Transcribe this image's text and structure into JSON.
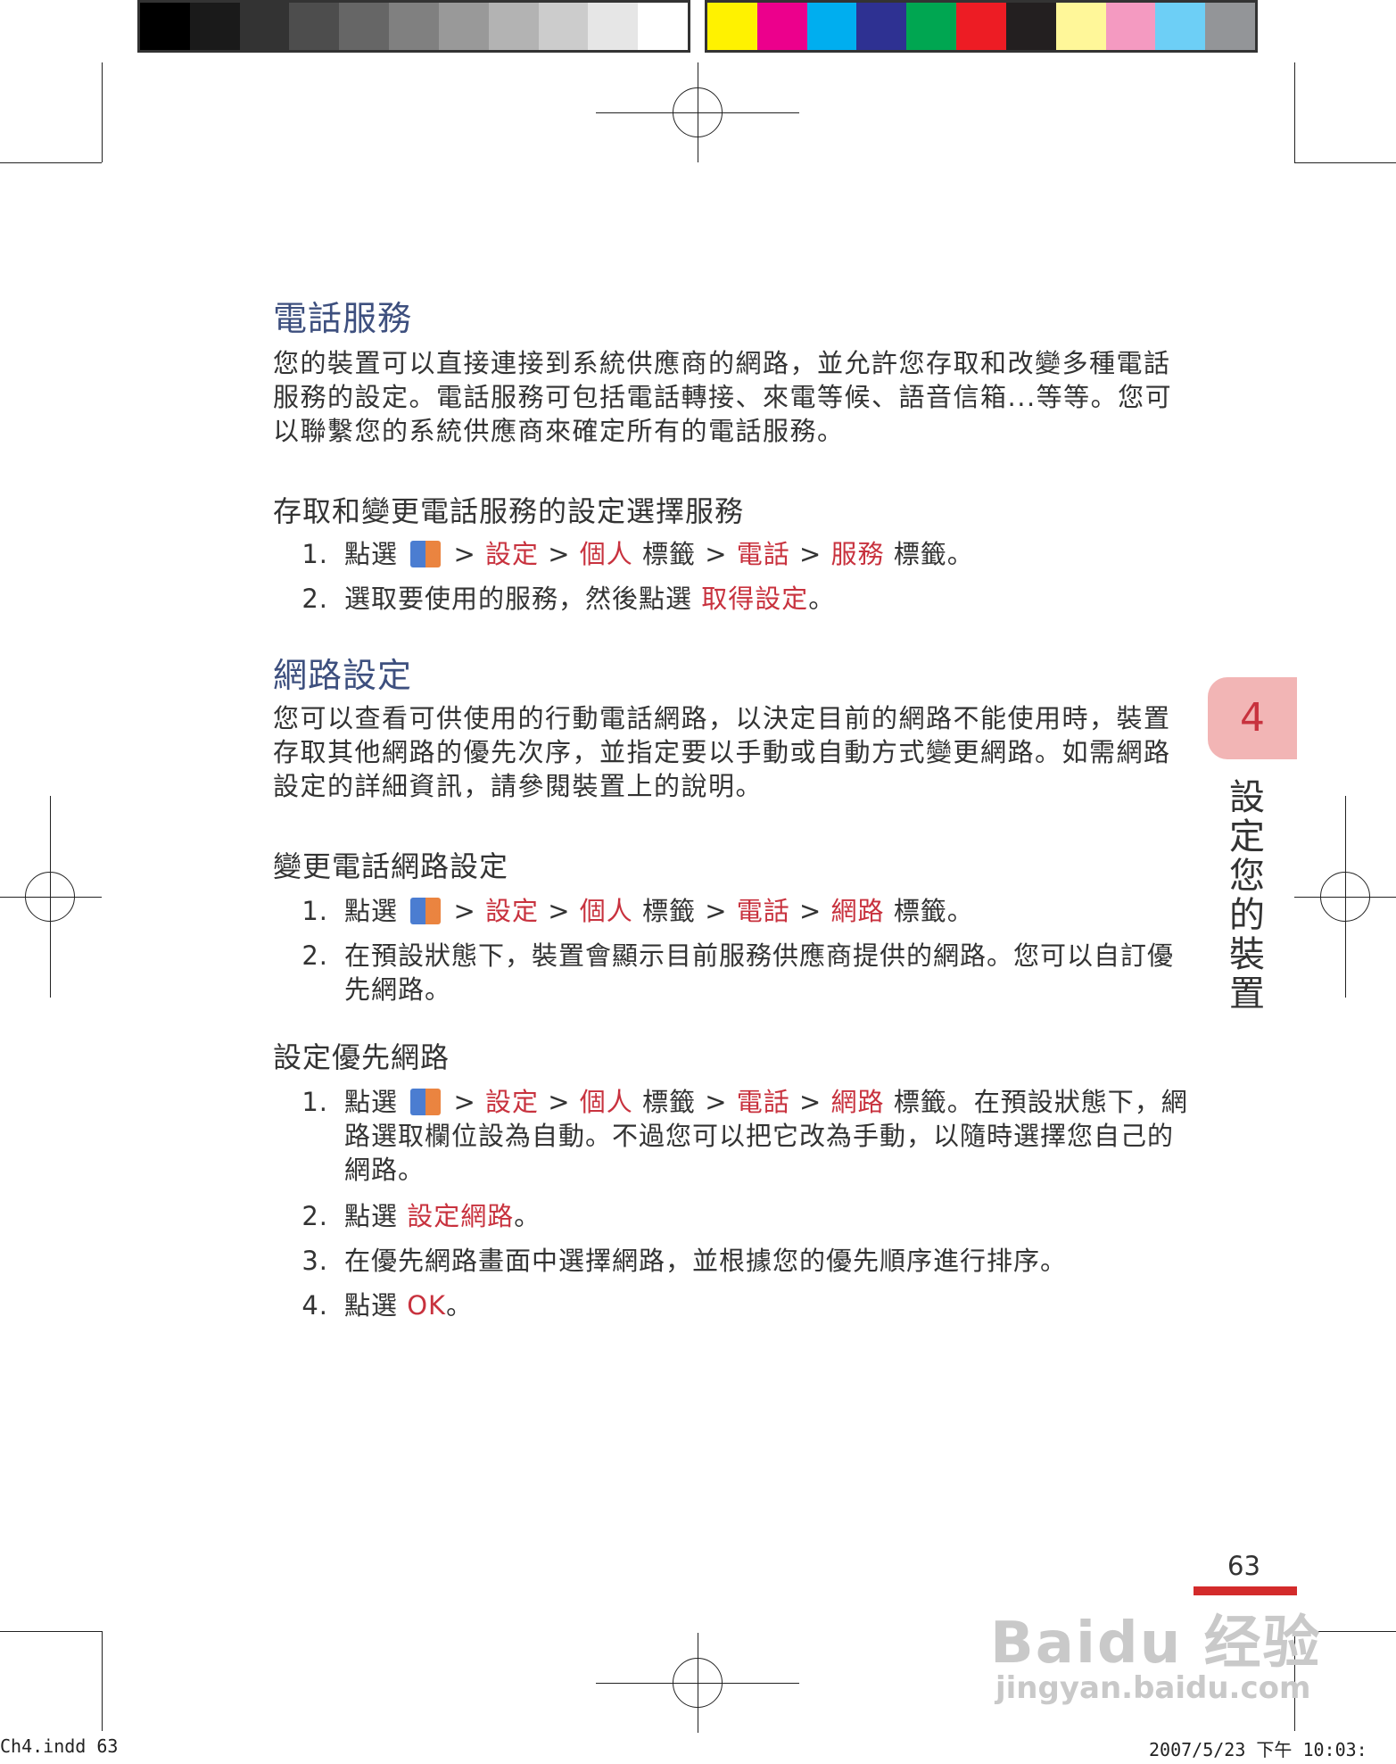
{
  "sections": [
    {
      "title": "電話服務",
      "paragraph": "您的裝置可以直接連接到系統供應商的網路，並允許您存取和改變多種電話服務的設定。電話服務可包括電話轉接、來電等候、語音信箱...等等。您可以聯繫您的系統供應商來確定所有的電話服務。",
      "subsection": "存取和變更電話服務的設定選擇服務",
      "steps": [
        {
          "num": "1.",
          "pre": "點選",
          "path": [
            "設定",
            "個人",
            "標籤",
            "電話",
            "服務",
            "標籤。"
          ]
        },
        {
          "num": "2.",
          "text": "選取要使用的服務，然後點選",
          "red": "取得設定",
          "post": "。"
        }
      ]
    },
    {
      "title": "網路設定",
      "paragraph": "您可以查看可供使用的行動電話網路，以決定目前的網路不能使用時，裝置存取其他網路的優先次序，並指定要以手動或自動方式變更網路。如需網路設定的詳細資訊，請參閱裝置上的說明。",
      "subsection_a": "變更電話網路設定",
      "steps_a": [
        {
          "num": "1.",
          "pre": "點選",
          "path": [
            "設定",
            "個人",
            "標籤",
            "電話",
            "網路",
            "標籤。"
          ]
        },
        {
          "num": "2.",
          "text": "在預設狀態下，裝置會顯示目前服務供應商提供的網路。您可以自訂優先網路。"
        }
      ],
      "subsection_b": "設定優先網路",
      "steps_b": [
        {
          "num": "1.",
          "pre": "點選",
          "path": [
            "設定",
            "個人",
            "標籤",
            "電話",
            "網路",
            "標籤。在預設狀態下，網路選取欄位設為自動。不過您可以把它改為手動，以隨時選擇您自己的網路。"
          ]
        },
        {
          "num": "2.",
          "pre": "點選",
          "red": "設定網路",
          "post": "。"
        },
        {
          "num": "3.",
          "text": "在優先網路畫面中選擇網路，並根據您的優先順序進行排序。"
        },
        {
          "num": "4.",
          "pre": "點選",
          "red": "OK",
          "post": "。"
        }
      ]
    }
  ],
  "sep": ">",
  "chapter": {
    "number": "4",
    "title": [
      "設",
      "定",
      "您",
      "的",
      "裝",
      "置"
    ]
  },
  "page_number": "63",
  "watermark": {
    "brand": "Bai",
    "brand2": "du",
    "cn": "经验",
    "url": "jingyan.baidu.com"
  },
  "slug": {
    "left": "Ch4.indd   63",
    "right": "2007/5/23   下午 10:03:"
  },
  "colors": {
    "heading": "#3d4f7e",
    "accent": "#c8323e",
    "tab": "#f2b5b5",
    "gray_swatches": [
      "#000000",
      "#1a1a1a",
      "#333333",
      "#4d4d4d",
      "#666666",
      "#808080",
      "#999999",
      "#b3b3b3",
      "#cccccc",
      "#e6e6e6",
      "#ffffff"
    ],
    "color_swatches": [
      "#fff200",
      "#ec008c",
      "#00aeef",
      "#2e3192",
      "#00a651",
      "#ed1c24",
      "#231f20",
      "#fff799",
      "#f49ac1",
      "#6dcff6",
      "#939598"
    ]
  }
}
